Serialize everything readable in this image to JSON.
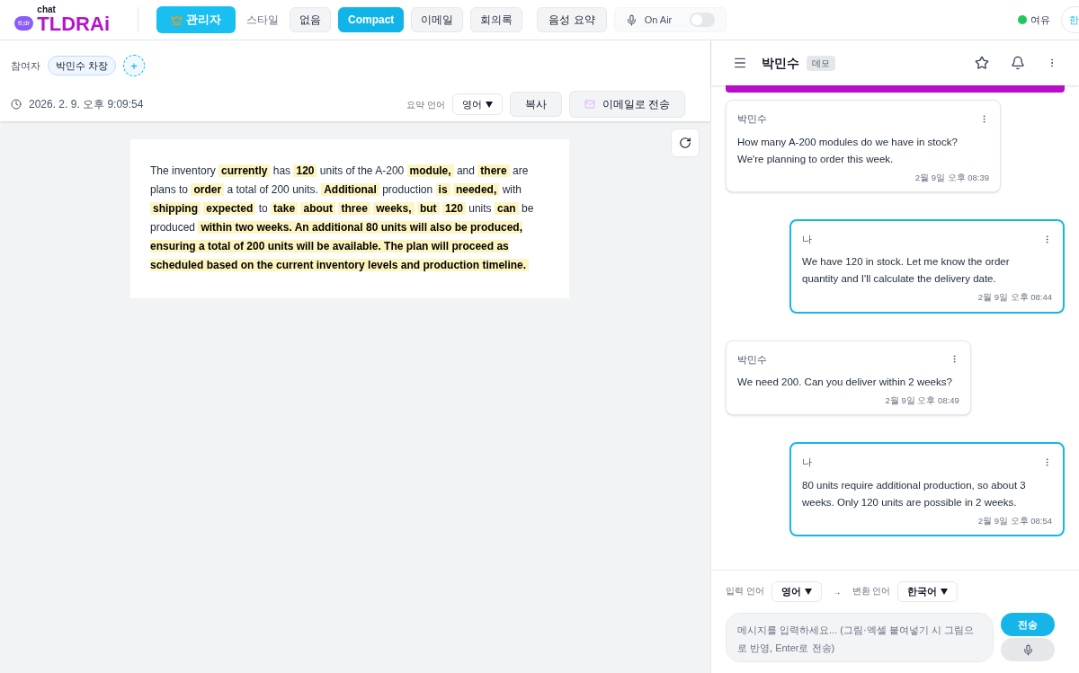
{
  "header": {
    "logo_small": "chat",
    "logo_badge": "tl;dr",
    "logo": "TLDRAi",
    "admin_button": "관리자",
    "style_label": "스타일",
    "styles": [
      {
        "label": "없음",
        "selected": false
      },
      {
        "label": "Compact",
        "selected": true
      },
      {
        "label": "이메일",
        "selected": false
      },
      {
        "label": "회의록",
        "selected": false
      }
    ],
    "voice_summary": "음성 요약",
    "on_air": {
      "label": "On Air",
      "on": false
    },
    "status": {
      "label": "여유",
      "color": "#22c55e"
    },
    "cut_button": "한"
  },
  "meeting": {
    "participants_label": "참여자",
    "participants": [
      "박민수 차장"
    ],
    "add": "+",
    "datetime": "2026. 2. 9. 오후 9:09:54",
    "summary_language_label": "요약 언어",
    "summary_language": "영어",
    "copy": "복사",
    "email": "이메일로 전송"
  },
  "summary": [
    {
      "text": "The inventory",
      "highlighted": false
    },
    {
      "text": "currently",
      "highlighted": true
    },
    {
      "text": "has",
      "highlighted": false
    },
    {
      "text": "120",
      "highlighted": true
    },
    {
      "text": "units of the A-200",
      "highlighted": false
    },
    {
      "text": "module,",
      "highlighted": true
    },
    {
      "text": "and",
      "highlighted": false
    },
    {
      "text": "there",
      "highlighted": true
    },
    {
      "text": "are plans to",
      "highlighted": false
    },
    {
      "text": "order",
      "highlighted": true
    },
    {
      "text": "a total of 200 units.",
      "highlighted": false
    },
    {
      "text": "Additional",
      "highlighted": true
    },
    {
      "text": "production",
      "highlighted": false
    },
    {
      "text": "is",
      "highlighted": true
    },
    {
      "text": "needed,",
      "highlighted": true
    },
    {
      "text": "with",
      "highlighted": false
    },
    {
      "text": "shipping",
      "highlighted": true
    },
    {
      "text": "expected",
      "highlighted": true
    },
    {
      "text": "to",
      "highlighted": false
    },
    {
      "text": "take",
      "highlighted": true
    },
    {
      "text": "about",
      "highlighted": true
    },
    {
      "text": "three",
      "highlighted": true
    },
    {
      "text": "weeks,",
      "highlighted": true
    },
    {
      "text": "but",
      "highlighted": true
    },
    {
      "text": "120",
      "highlighted": true
    },
    {
      "text": "units",
      "highlighted": false
    },
    {
      "text": "can",
      "highlighted": true
    },
    {
      "text": "be produced",
      "highlighted": false
    },
    {
      "text": "within two weeks. An additional 80 units will also be produced, ensuring a total of 200 units will be available. The plan will proceed as scheduled based on the current inventory levels and production timeline.",
      "highlighted": true
    }
  ],
  "chat": {
    "title": "박민수",
    "tag": "데모",
    "messages": [
      {
        "sender": "박민수",
        "mine": false,
        "text": "How many A-200 modules do we have in stock? We're planning to order this week.",
        "time": "2월 9일 오후 08:39"
      },
      {
        "sender": "나",
        "mine": true,
        "text": "We have 120 in stock. Let me know the order quantity and I'll calculate the delivery date.",
        "time": "2월 9일 오후 08:44"
      },
      {
        "sender": "박민수",
        "mine": false,
        "text": "We need 200. Can you deliver within 2 weeks?",
        "time": "2월 9일 오후 08:49"
      },
      {
        "sender": "나",
        "mine": true,
        "text": "80 units require additional production, so about 3 weeks. Only 120 units are possible in 2 weeks.",
        "time": "2월 9일 오후 08:54"
      }
    ],
    "input_language_label": "입력 언어",
    "input_language": "영어",
    "arrow": "→",
    "output_language_label": "변환 언어",
    "output_language": "한국어",
    "placeholder": "메시지를 입력하세요... (그림·엑셀 붙여넣기 시 그림으로 반영, Enter로 전송)",
    "send": "전송"
  }
}
